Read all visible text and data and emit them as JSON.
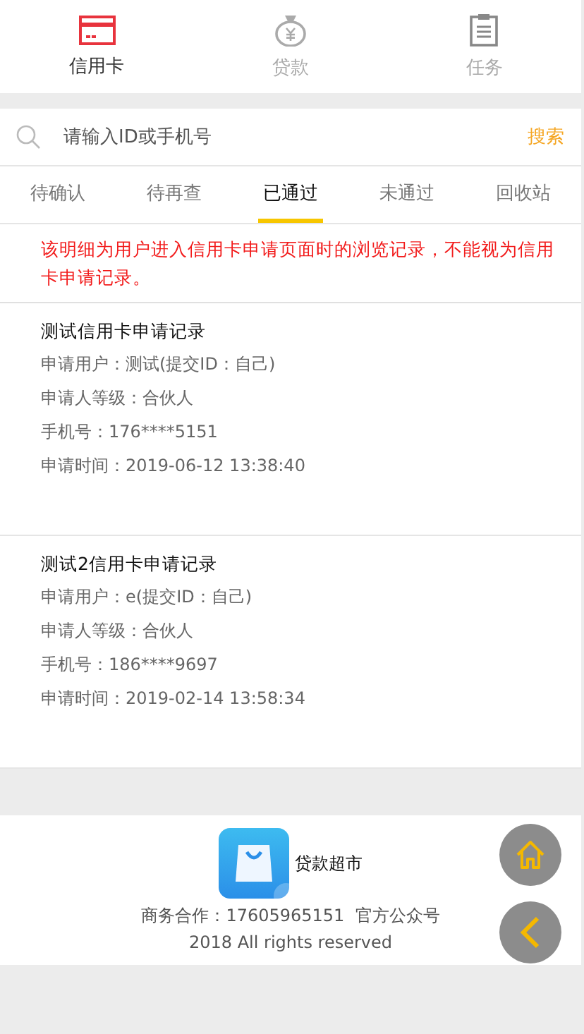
{
  "nav": [
    {
      "label": "信用卡",
      "kind": "card",
      "selected": true
    },
    {
      "label": "贷款",
      "kind": "moneybag",
      "selected": false
    },
    {
      "label": "任务",
      "kind": "clipboard",
      "selected": false
    }
  ],
  "search": {
    "placeholder": "请输入ID或手机号",
    "button": "搜索"
  },
  "tabs": [
    {
      "label": "待确认",
      "selected": false
    },
    {
      "label": "待再查",
      "selected": false
    },
    {
      "label": "已通过",
      "selected": true
    },
    {
      "label": "未通过",
      "selected": false
    },
    {
      "label": "回收站",
      "selected": false
    }
  ],
  "notice": "该明细为用户进入信用卡申请页面时的浏览记录，不能视为信用卡申请记录。",
  "records": [
    {
      "title": "测试信用卡申请记录",
      "lines": [
        "申请用户：测试(提交ID：自己)",
        "申请人等级：合伙人",
        "手机号：176****5151",
        "申请时间：2019-06-12 13:38:40"
      ]
    },
    {
      "title": "测试2信用卡申请记录",
      "lines": [
        "申请用户：e(提交ID：自己)",
        "申请人等级：合伙人",
        "手机号：186****9697",
        "申请时间：2019-02-14 13:58:34"
      ]
    }
  ],
  "footer": {
    "app_name": "贷款超市",
    "contact": "商务合作：17605965151  官方公众号",
    "copyright": "2018 All rights reserved"
  }
}
